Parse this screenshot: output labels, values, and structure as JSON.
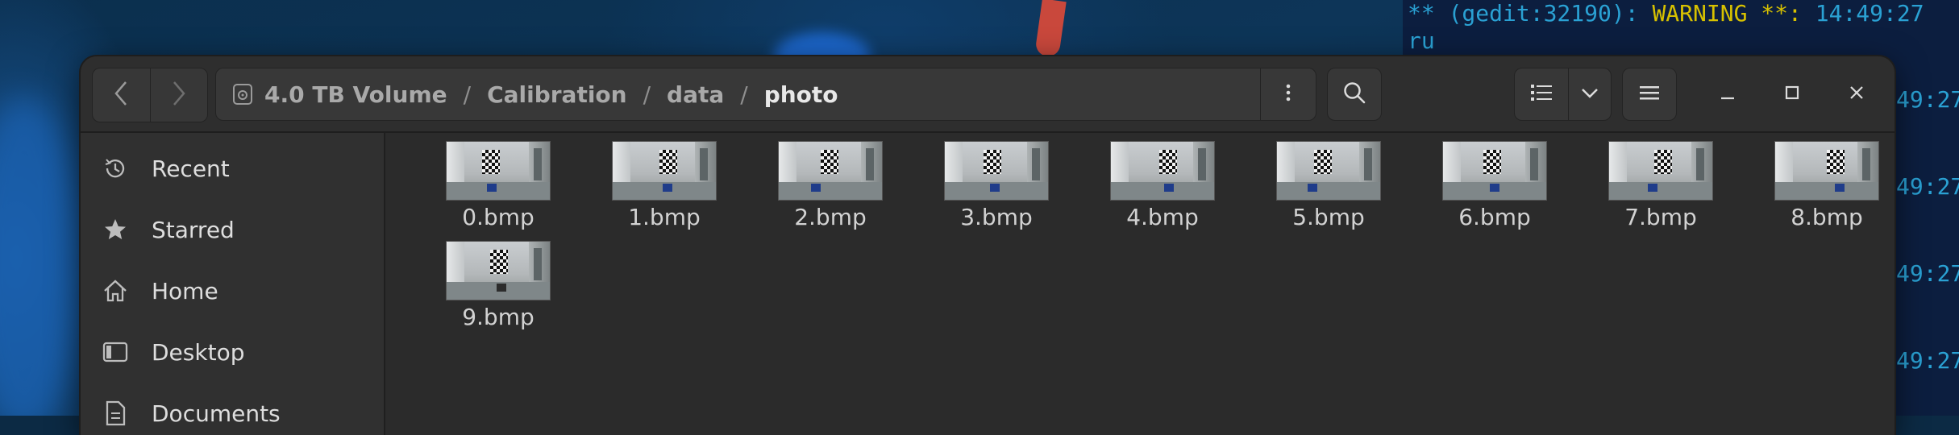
{
  "terminal": {
    "line1_prefix": "** (gedit:32190): ",
    "line1_warning": "WARNING **:",
    "line1_time": "14:49:27",
    "line2": "ru",
    "repeated_times": [
      "49:27",
      "49:27",
      "49:27",
      "49:27"
    ]
  },
  "window": {
    "nav": {
      "back_icon": "chevron-left-icon",
      "forward_icon": "chevron-right-icon"
    },
    "path": [
      "4.0 TB Volume",
      "Calibration",
      "data",
      "photo"
    ],
    "path_separator": "/",
    "icons": {
      "drive": "drive-icon",
      "path_menu": "vertical-dots-icon",
      "search": "search-icon",
      "list_view": "list-view-icon",
      "view_dropdown": "chevron-down-icon",
      "main_menu": "hamburger-icon",
      "minimize": "minimize-icon",
      "maximize": "maximize-icon",
      "close": "close-icon"
    }
  },
  "sidebar": {
    "items": [
      {
        "label": "Recent",
        "icon": "clock-icon"
      },
      {
        "label": "Starred",
        "icon": "star-icon"
      },
      {
        "label": "Home",
        "icon": "home-icon"
      },
      {
        "label": "Desktop",
        "icon": "desktop-icon"
      },
      {
        "label": "Documents",
        "icon": "document-icon"
      }
    ]
  },
  "files": [
    {
      "name": "0.bmp"
    },
    {
      "name": "1.bmp"
    },
    {
      "name": "2.bmp"
    },
    {
      "name": "3.bmp"
    },
    {
      "name": "4.bmp"
    },
    {
      "name": "5.bmp"
    },
    {
      "name": "6.bmp"
    },
    {
      "name": "7.bmp"
    },
    {
      "name": "8.bmp"
    },
    {
      "name": "9.bmp"
    }
  ],
  "colors": {
    "window_bg": "#2b2b2b",
    "sidebar_bg": "#303030",
    "terminal_text": "#2aa1d3",
    "terminal_warning": "#d7c100"
  }
}
